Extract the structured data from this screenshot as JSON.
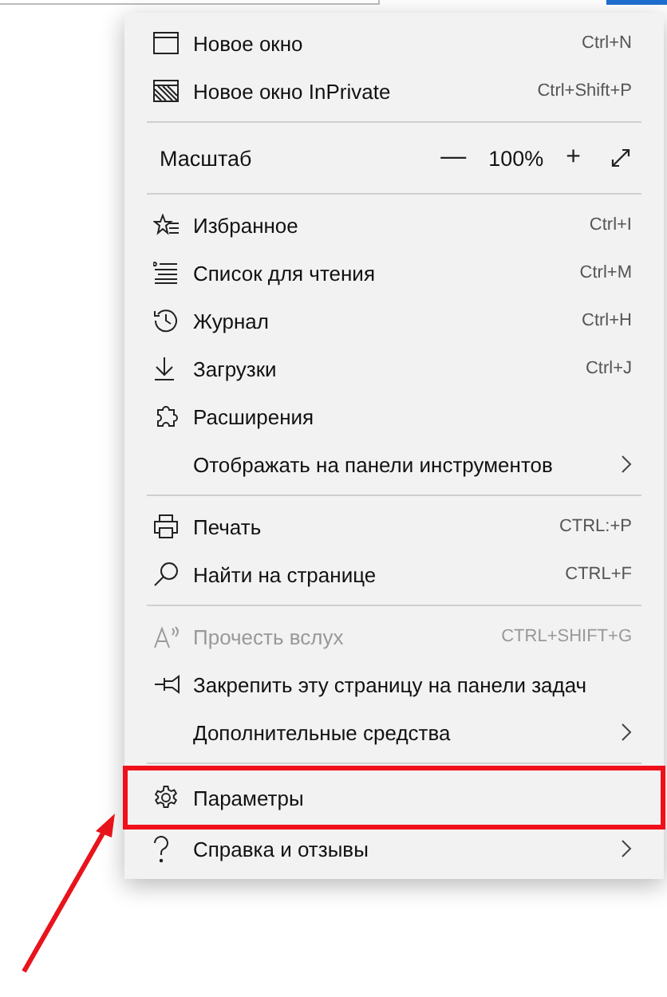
{
  "menu": {
    "sections": [
      {
        "items": [
          {
            "kind": "item",
            "label": "Новое окно",
            "shortcut": "Ctrl+N",
            "disabled": false,
            "submenu": false,
            "highlighted": false
          },
          {
            "kind": "item",
            "label": "Новое окно InPrivate",
            "shortcut": "Ctrl+Shift+P",
            "disabled": false,
            "submenu": false,
            "highlighted": false
          }
        ]
      },
      {
        "items": [
          {
            "kind": "zoom",
            "label": "Масштаб",
            "minus": "—",
            "value": "100%",
            "plus": "+"
          }
        ]
      },
      {
        "items": [
          {
            "kind": "item",
            "label": "Избранное",
            "shortcut": "Ctrl+I",
            "disabled": false,
            "submenu": false,
            "highlighted": false
          },
          {
            "kind": "item",
            "label": "Список для чтения",
            "shortcut": "Ctrl+M",
            "disabled": false,
            "submenu": false,
            "highlighted": false
          },
          {
            "kind": "item",
            "label": "Журнал",
            "shortcut": "Ctrl+H",
            "disabled": false,
            "submenu": false,
            "highlighted": false
          },
          {
            "kind": "item",
            "label": "Загрузки",
            "shortcut": "Ctrl+J",
            "disabled": false,
            "submenu": false,
            "highlighted": false
          },
          {
            "kind": "item",
            "label": "Расширения",
            "disabled": false,
            "submenu": false,
            "highlighted": false
          },
          {
            "kind": "item",
            "label": "Отображать на панели инструментов",
            "disabled": false,
            "submenu": true,
            "highlighted": false
          }
        ]
      },
      {
        "items": [
          {
            "kind": "item",
            "label": "Печать",
            "shortcut": "CTRL:+P",
            "disabled": false,
            "submenu": false,
            "highlighted": false
          },
          {
            "kind": "item",
            "label": "Найти на странице",
            "shortcut": "CTRL+F",
            "disabled": false,
            "submenu": false,
            "highlighted": false
          }
        ]
      },
      {
        "items": [
          {
            "kind": "item",
            "label": "Прочесть вслух",
            "shortcut": "CTRL+SHIFT+G",
            "disabled": true,
            "submenu": false,
            "highlighted": false
          },
          {
            "kind": "item",
            "label": "Закрепить эту страницу на панели задач",
            "disabled": false,
            "submenu": false,
            "highlighted": false
          },
          {
            "kind": "item",
            "label": "Дополнительные средства",
            "disabled": false,
            "submenu": true,
            "highlighted": false
          }
        ]
      },
      {
        "items": [
          {
            "kind": "item",
            "label": "Параметры",
            "disabled": false,
            "submenu": false,
            "highlighted": true
          },
          {
            "kind": "item",
            "label": "Справка и отзывы",
            "disabled": false,
            "submenu": true,
            "highlighted": false
          }
        ]
      }
    ]
  },
  "pointer_arrow": true
}
